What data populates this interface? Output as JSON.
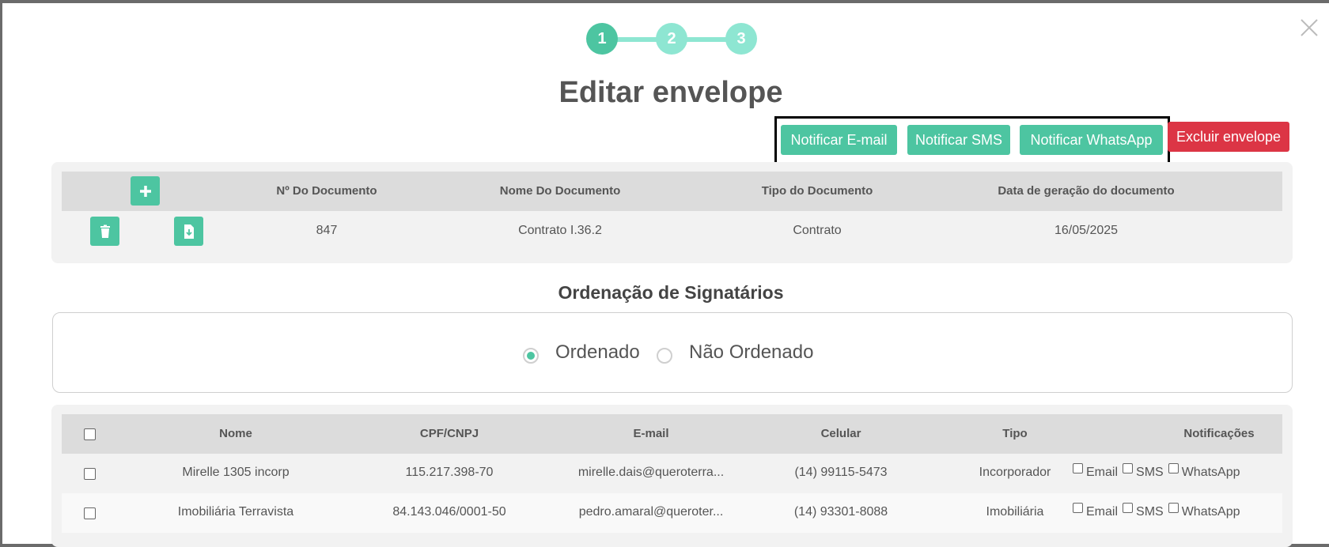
{
  "stepper": {
    "steps": [
      "1",
      "2",
      "3"
    ],
    "active_index": 0
  },
  "title": "Editar envelope",
  "actions": {
    "notify_email": "Notificar E-mail",
    "notify_sms": "Notificar SMS",
    "notify_whatsapp": "Notificar WhatsApp",
    "delete_envelope": "Excluir envelope"
  },
  "documents": {
    "headers": [
      "Nº Do Documento",
      "Nome Do Documento",
      "Tipo do Documento",
      "Data de geração do documento"
    ],
    "rows": [
      {
        "number": "847",
        "name": "Contrato I.36.2",
        "type": "Contrato",
        "date": "16/05/2025"
      }
    ]
  },
  "ordering": {
    "title": "Ordenação de Signatários",
    "options": [
      "Ordenado",
      "Não Ordenado"
    ],
    "selected": "Ordenado"
  },
  "signers": {
    "headers": [
      "Nome",
      "CPF/CNPJ",
      "E-mail",
      "Celular",
      "Tipo",
      "Notificações"
    ],
    "notification_labels": [
      "Email",
      "SMS",
      "WhatsApp"
    ],
    "rows": [
      {
        "name": "Mirelle 1305 incorp",
        "doc": "115.217.398-70",
        "email": "mirelle.dais@queroterra...",
        "phone": "(14) 99115-5473",
        "type": "Incorporador"
      },
      {
        "name": "Imobiliária Terravista",
        "doc": "84.143.046/0001-50",
        "email": "pedro.amaral@queroter...",
        "phone": "(14) 93301-8088",
        "type": "Imobiliária"
      }
    ]
  },
  "colors": {
    "accent": "#4dc5a1",
    "accent_light": "#8ee6d2",
    "danger": "#dc3545"
  }
}
